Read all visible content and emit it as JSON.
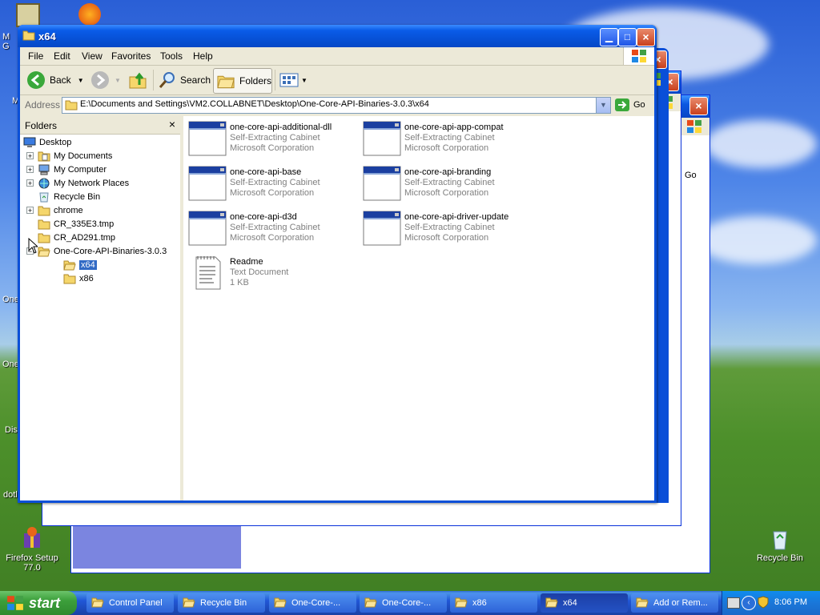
{
  "desktop": {
    "icons": [
      {
        "label": "Firefox Setup\n77.0"
      },
      {
        "label": "Recycle Bin"
      }
    ],
    "clipped_labels": [
      "M",
      "G",
      "M",
      "One",
      "One",
      "Dis",
      "dotl"
    ]
  },
  "back_windows": [
    {
      "go_label": "Go"
    },
    {
      "go_label": "Go"
    }
  ],
  "window": {
    "title": "x64",
    "menu": [
      "File",
      "Edit",
      "View",
      "Favorites",
      "Tools",
      "Help"
    ],
    "toolbar": {
      "back": "Back",
      "search": "Search",
      "folders": "Folders"
    },
    "address": {
      "label": "Address",
      "value": "E:\\Documents and Settings\\VM2.COLLABNET\\Desktop\\One-Core-API-Binaries-3.0.3\\x64",
      "go": "Go"
    },
    "folders_pane": {
      "title": "Folders",
      "close": "×",
      "tree": [
        {
          "label": "Desktop",
          "indent": 0,
          "expander": "none",
          "icon": "desktop-icon"
        },
        {
          "label": "My Documents",
          "indent": 1,
          "expander": "+",
          "icon": "my-documents-icon"
        },
        {
          "label": "My Computer",
          "indent": 1,
          "expander": "+",
          "icon": "my-computer-icon"
        },
        {
          "label": "My Network Places",
          "indent": 1,
          "expander": "+",
          "icon": "network-places-icon"
        },
        {
          "label": "Recycle Bin",
          "indent": 1,
          "expander": "none",
          "icon": "recycle-bin-icon"
        },
        {
          "label": "chrome",
          "indent": 1,
          "expander": "+",
          "icon": "folder-icon"
        },
        {
          "label": "CR_335E3.tmp",
          "indent": 1,
          "expander": "none",
          "icon": "folder-icon"
        },
        {
          "label": "CR_AD291.tmp",
          "indent": 1,
          "expander": "none",
          "icon": "folder-icon"
        },
        {
          "label": "One-Core-API-Binaries-3.0.3",
          "indent": 1,
          "expander": "-",
          "icon": "folder-open-icon"
        },
        {
          "label": "x64",
          "indent": 2,
          "expander": "none",
          "icon": "folder-open-icon",
          "selected": true
        },
        {
          "label": "x86",
          "indent": 2,
          "expander": "none",
          "icon": "folder-icon"
        }
      ]
    },
    "files": [
      {
        "name": "one-core-api-additional-dll",
        "type": "Self-Extracting Cabinet",
        "company": "Microsoft Corporation",
        "icon": "cabinet-icon"
      },
      {
        "name": "one-core-api-app-compat",
        "type": "Self-Extracting Cabinet",
        "company": "Microsoft Corporation",
        "icon": "cabinet-icon"
      },
      {
        "name": "one-core-api-base",
        "type": "Self-Extracting Cabinet",
        "company": "Microsoft Corporation",
        "icon": "cabinet-icon"
      },
      {
        "name": "one-core-api-branding",
        "type": "Self-Extracting Cabinet",
        "company": "Microsoft Corporation",
        "icon": "cabinet-icon"
      },
      {
        "name": "one-core-api-d3d",
        "type": "Self-Extracting Cabinet",
        "company": "Microsoft Corporation",
        "icon": "cabinet-icon"
      },
      {
        "name": "one-core-api-driver-update",
        "type": "Self-Extracting Cabinet",
        "company": "Microsoft Corporation",
        "icon": "cabinet-icon"
      },
      {
        "name": "Readme",
        "type": "Text Document",
        "company": "1 KB",
        "icon": "text-document-icon"
      }
    ]
  },
  "taskbar": {
    "start": "start",
    "tasks": [
      {
        "label": "Control Panel",
        "active": false
      },
      {
        "label": "Recycle Bin",
        "active": false
      },
      {
        "label": "One-Core-...",
        "active": false
      },
      {
        "label": "One-Core-...",
        "active": false
      },
      {
        "label": "x86",
        "active": false
      },
      {
        "label": "x64",
        "active": true
      },
      {
        "label": "Add or Rem...",
        "active": false
      }
    ],
    "clock": "8:06 PM"
  }
}
